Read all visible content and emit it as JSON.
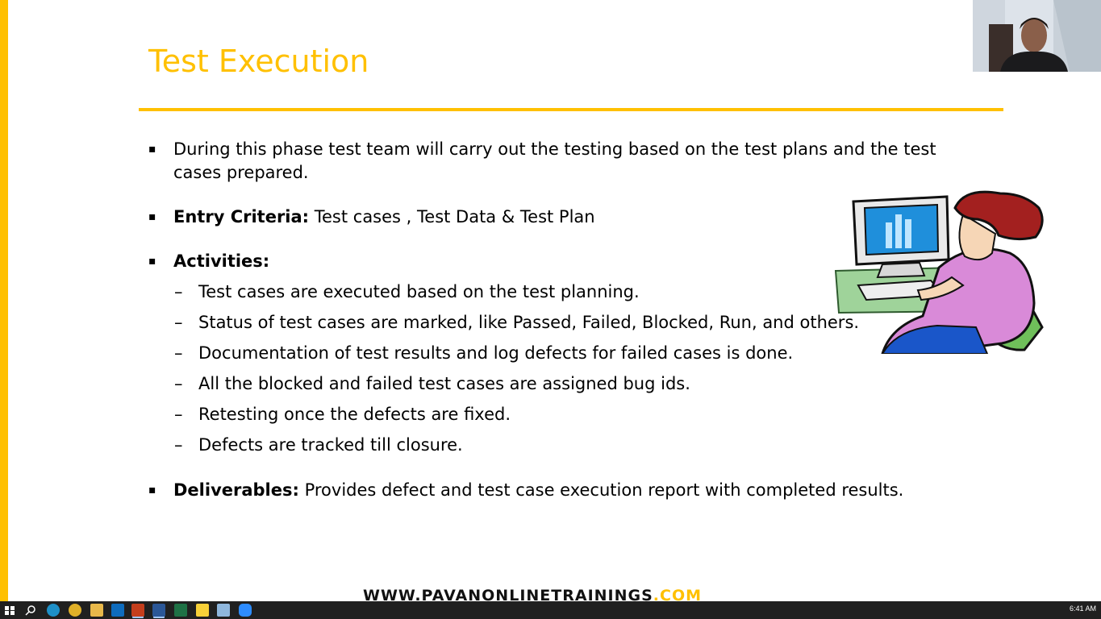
{
  "slide": {
    "title": "Test Execution",
    "bullets": {
      "intro": "During this phase test team will carry out the testing based on the test plans and the test cases prepared.",
      "entry_label": "Entry Criteria:",
      "entry_text": " Test cases , Test Data & Test Plan",
      "activities_label": "Activities:",
      "activities": [
        "Test cases are executed based on the test planning.",
        "Status of test cases are marked, like Passed, Failed, Blocked, Run, and others.",
        "Documentation of test results and log defects for failed cases is done.",
        "All the blocked and failed test cases are assigned bug ids.",
        "Retesting once the defects are fixed.",
        "Defects are tracked till closure."
      ],
      "deliverables_label": "Deliverables:",
      "deliverables_text": " Provides defect and test case execution report with completed results."
    },
    "bullet_mark": "▪",
    "dash_mark": "–"
  },
  "watermark": {
    "prefix": "WWW.PAVANONLINETRAININGS",
    "suffix": ".COM"
  },
  "taskbar": {
    "clock": "6:41 AM",
    "icons": [
      "windows-start-icon",
      "search-icon",
      "edge-icon",
      "chrome-icon",
      "file-explorer-icon",
      "outlook-icon",
      "powerpoint-icon",
      "word-icon",
      "excel-icon",
      "sticky-notes-icon",
      "notepad-icon",
      "zoom-icon"
    ]
  },
  "colors": {
    "accent": "#FFC000",
    "taskbar": "#202020"
  }
}
